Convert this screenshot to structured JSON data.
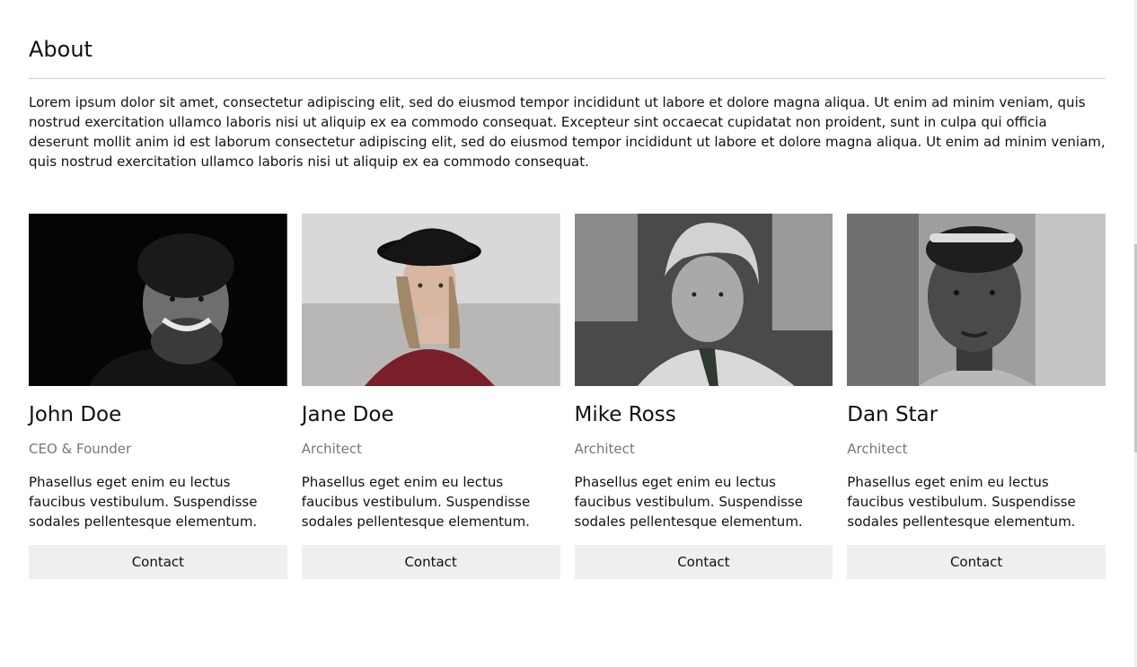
{
  "about": {
    "title": "About",
    "text": "Lorem ipsum dolor sit amet, consectetur adipiscing elit, sed do eiusmod tempor incididunt ut labore et dolore magna aliqua. Ut enim ad minim veniam, quis nostrud exercitation ullamco laboris nisi ut aliquip ex ea commodo consequat. Excepteur sint occaecat cupidatat non proident, sunt in culpa qui officia deserunt mollit anim id est laborum consectetur adipiscing elit, sed do eiusmod tempor incididunt ut labore et dolore magna aliqua. Ut enim ad minim veniam, quis nostrud exercitation ullamco laboris nisi ut aliquip ex ea commodo consequat."
  },
  "team": [
    {
      "name": "John Doe",
      "role": "CEO & Founder",
      "bio": "Phasellus eget enim eu lectus faucibus vestibulum. Suspendisse sodales pellentesque elementum.",
      "button": "Contact"
    },
    {
      "name": "Jane Doe",
      "role": "Architect",
      "bio": "Phasellus eget enim eu lectus faucibus vestibulum. Suspendisse sodales pellentesque elementum.",
      "button": "Contact"
    },
    {
      "name": "Mike Ross",
      "role": "Architect",
      "bio": "Phasellus eget enim eu lectus faucibus vestibulum. Suspendisse sodales pellentesque elementum.",
      "button": "Contact"
    },
    {
      "name": "Dan Star",
      "role": "Architect",
      "bio": "Phasellus eget enim eu lectus faucibus vestibulum. Suspendisse sodales pellentesque elementum.",
      "button": "Contact"
    }
  ],
  "colors": {
    "button_bg": "#efefef",
    "divider": "#cfcfcf",
    "role_text": "#777777"
  }
}
